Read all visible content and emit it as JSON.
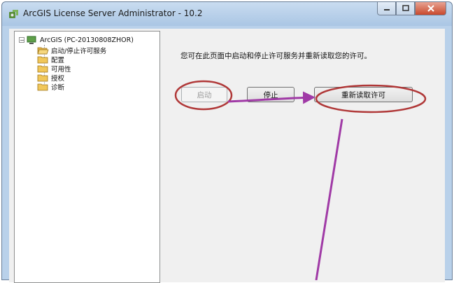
{
  "window": {
    "title": "ArcGIS License Server Administrator - 10.2",
    "app_icon": "arcgis-tool-icon"
  },
  "controls": {
    "minimize_icon": "minimize-icon",
    "maximize_icon": "maximize-icon",
    "close_icon": "close-icon"
  },
  "tree": {
    "root": {
      "label": "ArcGIS (PC-20130808ZHOR)",
      "expander": "−",
      "icon": "computer-icon"
    },
    "items": [
      {
        "label": "启动/停止许可服务",
        "icon": "folder-open-icon",
        "selected": true
      },
      {
        "label": "配置",
        "icon": "folder-icon"
      },
      {
        "label": "可用性",
        "icon": "folder-icon"
      },
      {
        "label": "授权",
        "icon": "folder-icon"
      },
      {
        "label": "诊断",
        "icon": "folder-icon"
      }
    ]
  },
  "pane": {
    "description": "您可在此页面中启动和停止许可服务并重新读取您的许可。",
    "buttons": {
      "start": {
        "label": "启动",
        "enabled": false
      },
      "stop": {
        "label": "停止",
        "enabled": true
      },
      "reread": {
        "label": "重新读取许可",
        "enabled": true
      }
    }
  },
  "annotations": {
    "circle_color": "#b03838",
    "arrow_color": "#a03aa6"
  }
}
